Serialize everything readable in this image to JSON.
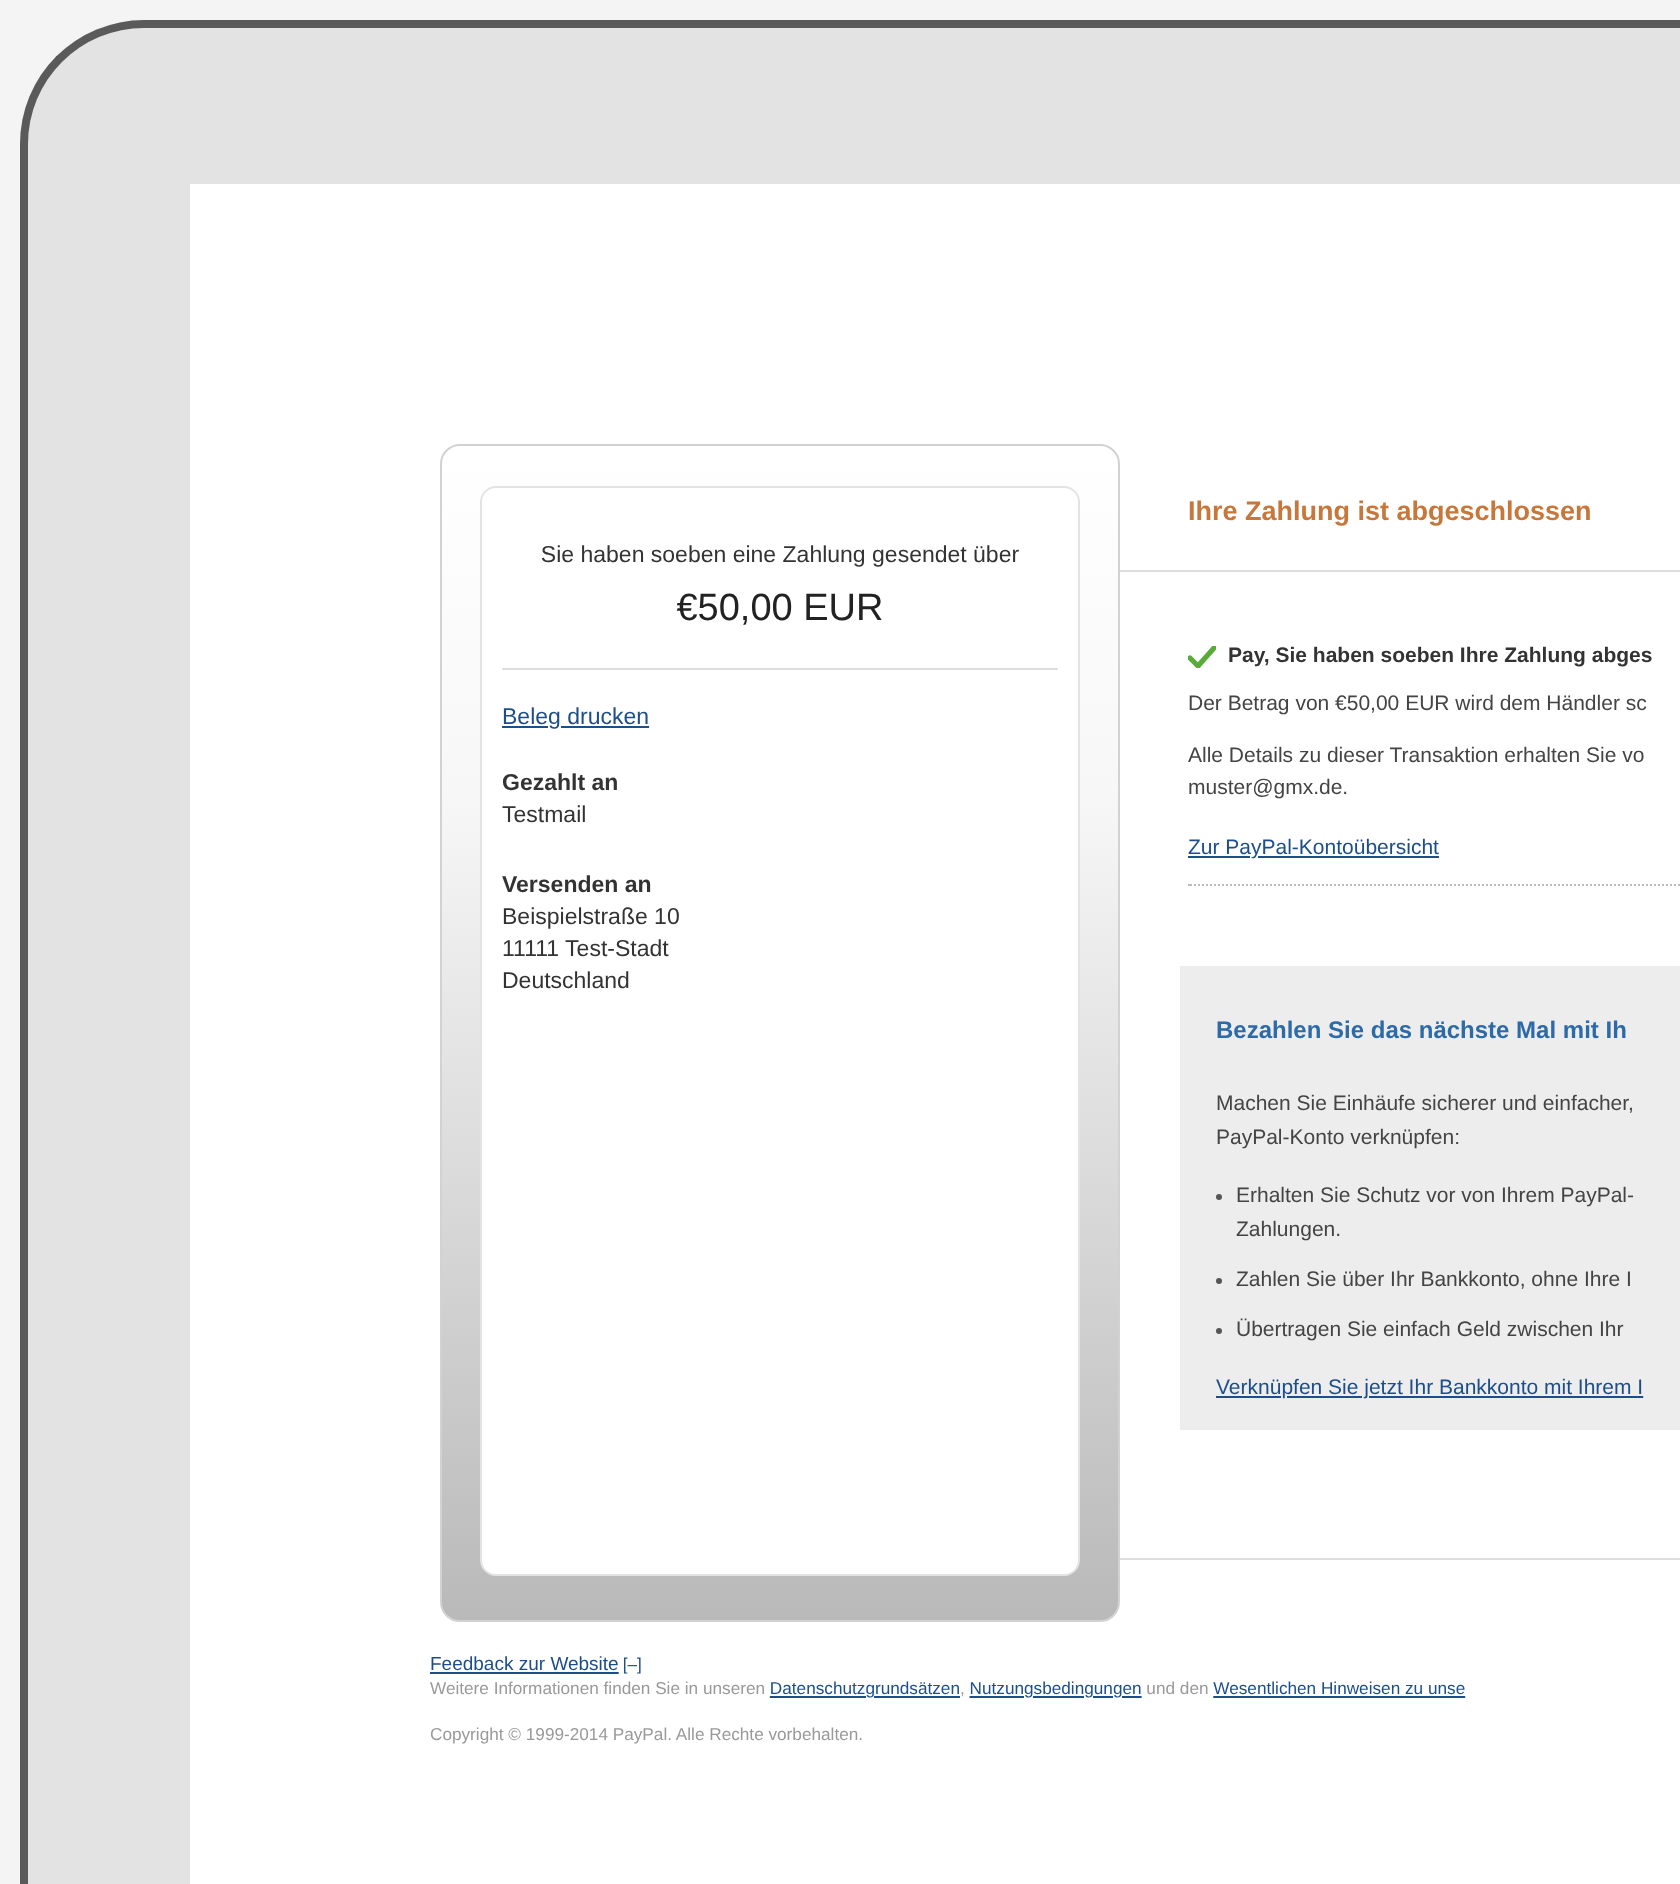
{
  "summary": {
    "intro": "Sie haben soeben eine Zahlung gesendet über",
    "amount": "€50,00 EUR",
    "print_link": "Beleg drucken",
    "paid_to": {
      "label": "Gezahlt an",
      "lines": [
        "Testmail"
      ]
    },
    "ship_to": {
      "label": "Versenden an",
      "lines": [
        "Beispielstraße 10",
        "11111 Test-Stadt",
        "Deutschland"
      ]
    }
  },
  "confirmation": {
    "title": "Ihre Zahlung ist abgeschlossen",
    "success": "Pay, Sie haben soeben Ihre Zahlung abges",
    "paragraphs": [
      [
        "Der Betrag von €50,00 EUR wird dem Händler sc"
      ],
      [
        "Alle Details zu dieser Transaktion erhalten Sie vo",
        "muster@gmx.de."
      ]
    ],
    "account_link": "Zur PayPal-Kontoübersicht"
  },
  "promo": {
    "title": "Bezahlen Sie das nächste Mal mit Ih",
    "intro": [
      "Machen Sie Einhäufe sicherer und einfacher,",
      "PayPal-Konto verknüpfen:"
    ],
    "bullets": [
      [
        "Erhalten Sie Schutz vor von Ihrem PayPal-",
        "Zahlungen."
      ],
      [
        "Zahlen Sie über Ihr Bankkonto, ohne Ihre I"
      ],
      [
        "Übertragen Sie einfach Geld zwischen Ihr"
      ]
    ],
    "link": "Verknüpfen Sie jetzt Ihr Bankkonto mit Ihrem I"
  },
  "footer": {
    "feedback_link": "Feedback zur Website",
    "feedback_toggle": "[–]",
    "info": [
      {
        "text": "Weitere Informationen finden Sie in unseren ",
        "link": "Datenschutzgrundsätzen"
      },
      {
        "text": ", ",
        "link": "Nutzungsbedingungen"
      },
      {
        "text": " und den ",
        "link": "Wesentlichen Hinweisen zu unse"
      }
    ],
    "copyright": "Copyright © 1999-2014 PayPal. Alle Rechte vorbehalten."
  }
}
